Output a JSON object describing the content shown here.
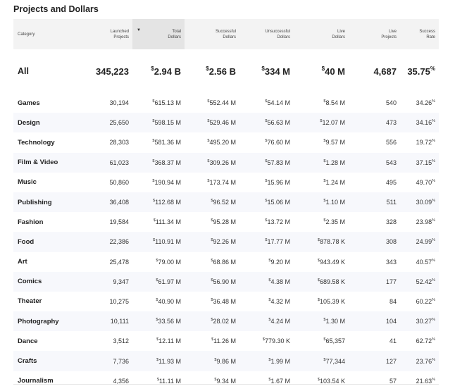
{
  "title": "Projects and Dollars",
  "sort_indicator": "▼",
  "columns": [
    {
      "key": "category",
      "label": "Category"
    },
    {
      "key": "launched_projects",
      "label": "Launched\nProjects"
    },
    {
      "key": "total_dollars",
      "label": "Total\nDollars"
    },
    {
      "key": "successful_dollars",
      "label": "Successful\nDollars"
    },
    {
      "key": "unsuccessful_dollars",
      "label": "Unsuccessful\nDollars"
    },
    {
      "key": "live_dollars",
      "label": "Live\nDollars"
    },
    {
      "key": "live_projects",
      "label": "Live\nProjects"
    },
    {
      "key": "success_rate",
      "label": "Success\nRate"
    }
  ],
  "summary": {
    "category": "All",
    "launched_projects": "345,223",
    "total_dollars": "2.94 B",
    "successful_dollars": "2.56 B",
    "unsuccessful_dollars": "334 M",
    "live_dollars": "40 M",
    "live_projects": "4,687",
    "success_rate": "35.75"
  },
  "currency_symbol": "$",
  "percent_symbol": "%",
  "rows": [
    {
      "category": "Games",
      "launched_projects": "30,194",
      "total_dollars": "615.13 M",
      "successful_dollars": "552.44 M",
      "unsuccessful_dollars": "54.14 M",
      "live_dollars": "8.54 M",
      "live_projects": "540",
      "success_rate": "34.26"
    },
    {
      "category": "Design",
      "launched_projects": "25,650",
      "total_dollars": "598.15 M",
      "successful_dollars": "529.46 M",
      "unsuccessful_dollars": "56.63 M",
      "live_dollars": "12.07 M",
      "live_projects": "473",
      "success_rate": "34.16"
    },
    {
      "category": "Technology",
      "launched_projects": "28,303",
      "total_dollars": "581.36 M",
      "successful_dollars": "495.20 M",
      "unsuccessful_dollars": "76.60 M",
      "live_dollars": "9.57 M",
      "live_projects": "556",
      "success_rate": "19.72"
    },
    {
      "category": "Film & Video",
      "launched_projects": "61,023",
      "total_dollars": "368.37 M",
      "successful_dollars": "309.26 M",
      "unsuccessful_dollars": "57.83 M",
      "live_dollars": "1.28 M",
      "live_projects": "543",
      "success_rate": "37.15"
    },
    {
      "category": "Music",
      "launched_projects": "50,860",
      "total_dollars": "190.94 M",
      "successful_dollars": "173.74 M",
      "unsuccessful_dollars": "15.96 M",
      "live_dollars": "1.24 M",
      "live_projects": "495",
      "success_rate": "49.70"
    },
    {
      "category": "Publishing",
      "launched_projects": "36,408",
      "total_dollars": "112.68 M",
      "successful_dollars": "96.52 M",
      "unsuccessful_dollars": "15.06 M",
      "live_dollars": "1.10 M",
      "live_projects": "511",
      "success_rate": "30.09"
    },
    {
      "category": "Fashion",
      "launched_projects": "19,584",
      "total_dollars": "111.34 M",
      "successful_dollars": "95.28 M",
      "unsuccessful_dollars": "13.72 M",
      "live_dollars": "2.35 M",
      "live_projects": "328",
      "success_rate": "23.98"
    },
    {
      "category": "Food",
      "launched_projects": "22,386",
      "total_dollars": "110.91 M",
      "successful_dollars": "92.26 M",
      "unsuccessful_dollars": "17.77 M",
      "live_dollars": "878.78 K",
      "live_projects": "308",
      "success_rate": "24.99"
    },
    {
      "category": "Art",
      "launched_projects": "25,478",
      "total_dollars": "79.00 M",
      "successful_dollars": "68.86 M",
      "unsuccessful_dollars": "9.20 M",
      "live_dollars": "943.49 K",
      "live_projects": "343",
      "success_rate": "40.57"
    },
    {
      "category": "Comics",
      "launched_projects": "9,347",
      "total_dollars": "61.97 M",
      "successful_dollars": "56.90 M",
      "unsuccessful_dollars": "4.38 M",
      "live_dollars": "689.58 K",
      "live_projects": "177",
      "success_rate": "52.42"
    },
    {
      "category": "Theater",
      "launched_projects": "10,275",
      "total_dollars": "40.90 M",
      "successful_dollars": "36.48 M",
      "unsuccessful_dollars": "4.32 M",
      "live_dollars": "105.39 K",
      "live_projects": "84",
      "success_rate": "60.22"
    },
    {
      "category": "Photography",
      "launched_projects": "10,111",
      "total_dollars": "33.56 M",
      "successful_dollars": "28.02 M",
      "unsuccessful_dollars": "4.24 M",
      "live_dollars": "1.30 M",
      "live_projects": "104",
      "success_rate": "30.27"
    },
    {
      "category": "Dance",
      "launched_projects": "3,512",
      "total_dollars": "12.11 M",
      "successful_dollars": "11.26 M",
      "unsuccessful_dollars": "779.30 K",
      "live_dollars": "65,357",
      "live_projects": "41",
      "success_rate": "62.72"
    },
    {
      "category": "Crafts",
      "launched_projects": "7,736",
      "total_dollars": "11.93 M",
      "successful_dollars": "9.86 M",
      "unsuccessful_dollars": "1.99 M",
      "live_dollars": "77,344",
      "live_projects": "127",
      "success_rate": "23.76"
    },
    {
      "category": "Journalism",
      "launched_projects": "4,356",
      "total_dollars": "11.11 M",
      "successful_dollars": "9.34 M",
      "unsuccessful_dollars": "1.67 M",
      "live_dollars": "103.54 K",
      "live_projects": "57",
      "success_rate": "21.63"
    }
  ]
}
